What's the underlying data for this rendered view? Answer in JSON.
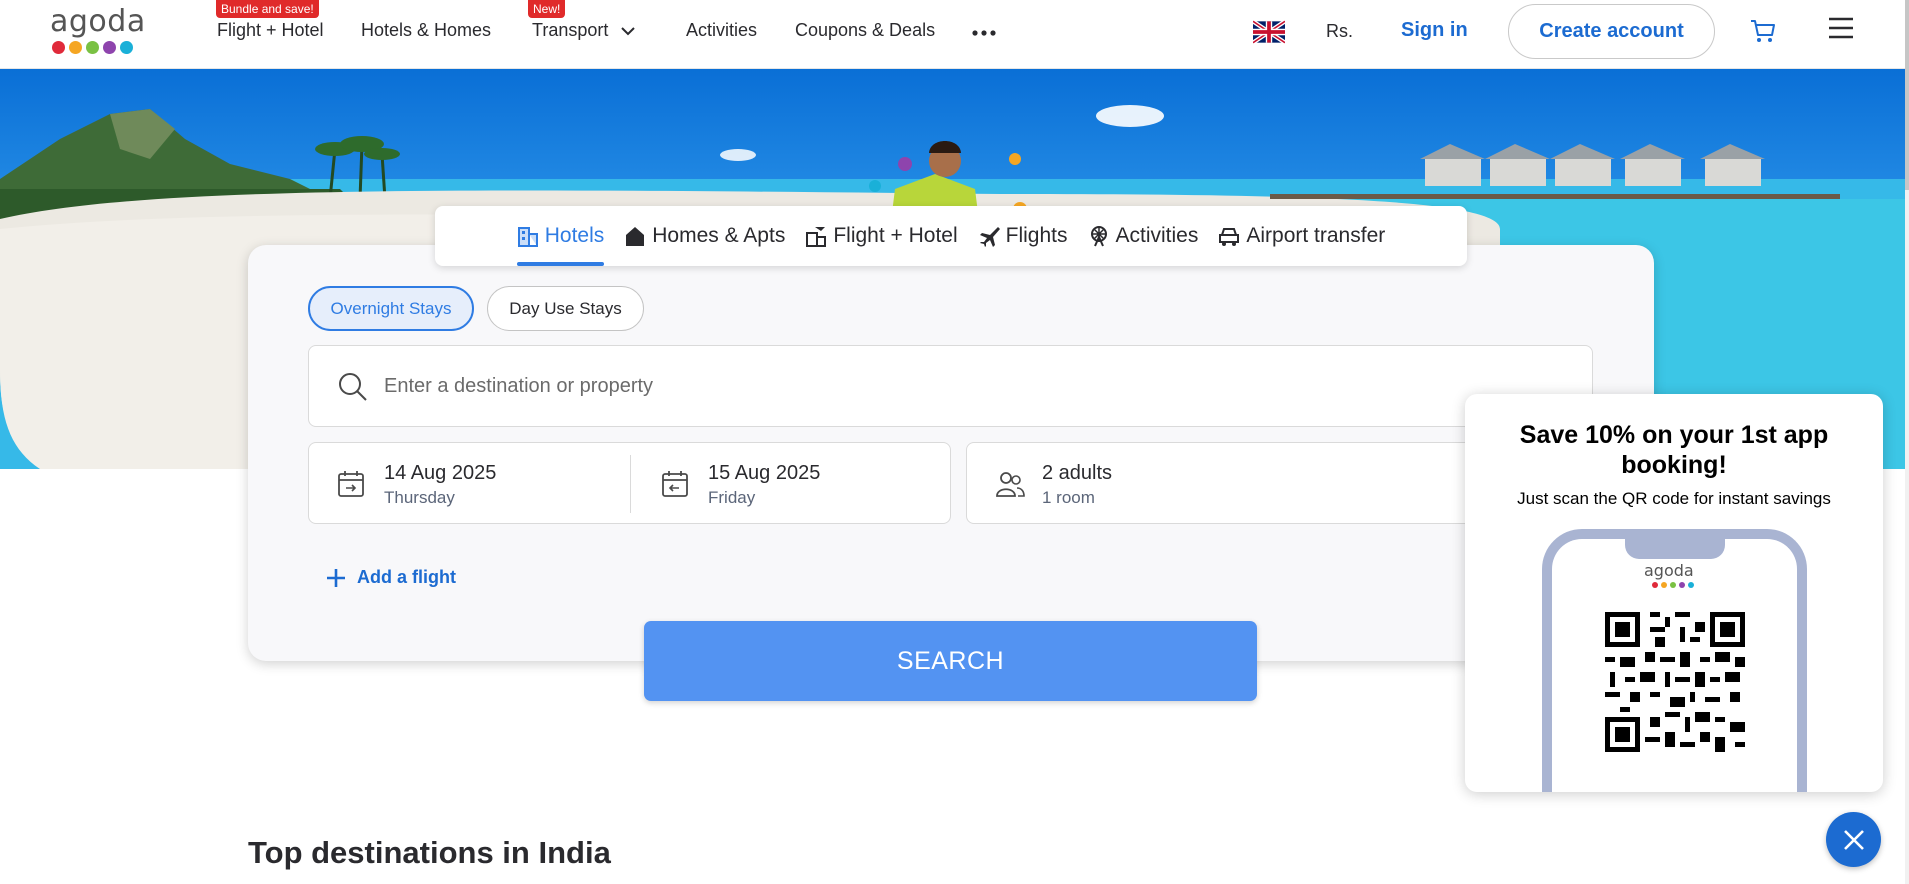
{
  "header": {
    "logo_text": "agoda",
    "logo_colors": [
      "#e02a3a",
      "#f5a623",
      "#7ac143",
      "#8e44ad",
      "#1ab0d8"
    ],
    "nav": [
      {
        "label": "Flight + Hotel",
        "badge": "Bundle and save!"
      },
      {
        "label": "Hotels & Homes"
      },
      {
        "label": "Transport",
        "badge": "New!"
      },
      {
        "label": "Activities"
      },
      {
        "label": "Coupons & Deals"
      }
    ],
    "more_icon": "more-horizontal-icon",
    "currency": "Rs.",
    "sign_in": "Sign in",
    "create_account": "Create account",
    "cart_icon": "cart-icon",
    "menu_icon": "hamburger-menu-icon"
  },
  "product_tabs": [
    {
      "label": "Hotels",
      "icon": "hotel-building-icon",
      "active": true
    },
    {
      "label": "Homes & Apts",
      "icon": "home-icon"
    },
    {
      "label": "Flight + Hotel",
      "icon": "flight-hotel-icon"
    },
    {
      "label": "Flights",
      "icon": "airplane-icon"
    },
    {
      "label": "Activities",
      "icon": "ferris-wheel-icon"
    },
    {
      "label": "Airport transfer",
      "icon": "car-icon"
    }
  ],
  "search": {
    "stay_types": [
      "Overnight Stays",
      "Day Use Stays"
    ],
    "selected_stay_type": "Overnight Stays",
    "destination_placeholder": "Enter a destination or property",
    "destination_value": "",
    "check_in": {
      "date": "14 Aug 2025",
      "day": "Thursday"
    },
    "check_out": {
      "date": "15 Aug 2025",
      "day": "Friday"
    },
    "guests": {
      "adults": "2 adults",
      "rooms": "1 room"
    },
    "add_flight": "Add a flight",
    "search_button": "SEARCH"
  },
  "main": {
    "section_title": "Top destinations in India"
  },
  "app_promo": {
    "title": "Save 10% on your 1st app booking!",
    "subtitle": "Just scan the QR code for instant savings",
    "phone_logo": "agoda"
  },
  "colors": {
    "brand_blue": "#1c6bd1",
    "search_button": "#5393f2",
    "badge_red": "#e02a2a"
  }
}
